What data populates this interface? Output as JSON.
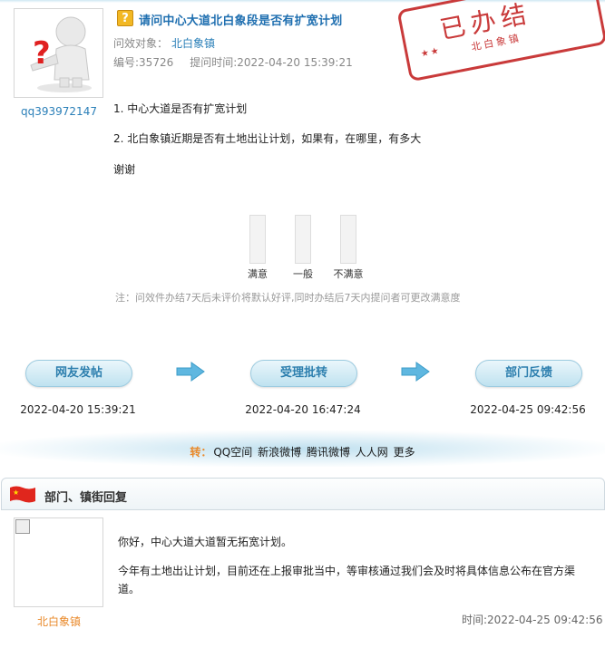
{
  "question": {
    "title": "请问中心大道北白象段是否有扩宽计划",
    "target_label": "问效对象：",
    "target": "北白象镇",
    "number": "编号:35726",
    "time": "提问时间:2022-04-20 15:39:21",
    "asker": "qq393972147",
    "body": [
      "1. 中心大道是否有扩宽计划",
      "2. 北白象镇近期是否有土地出让计划，如果有，在哪里，有多大",
      "谢谢"
    ]
  },
  "stamp": {
    "text": "已办结",
    "sub": "北白象镇"
  },
  "rating": {
    "options": [
      "满意",
      "一般",
      "不满意"
    ],
    "note": "注：问效件办结7天后未评价将默认好评,同时办结后7天内提问者可更改满意度"
  },
  "flow": [
    {
      "label": "网友发帖",
      "date": "2022-04-20 15:39:21"
    },
    {
      "label": "受理批转",
      "date": "2022-04-20 16:47:24"
    },
    {
      "label": "部门反馈",
      "date": "2022-04-25 09:42:56"
    }
  ],
  "share": {
    "prefix": "转：",
    "links": [
      "QQ空间",
      "新浪微博",
      "腾讯微博",
      "人人网",
      "更多"
    ]
  },
  "reply": {
    "section_title": "部门、镇街回复",
    "author": "北白象镇",
    "paragraphs": [
      "你好，中心大道大道暂无拓宽计划。",
      "今年有土地出让计划，目前还在上报审批当中，等审核通过我们会及时将具体信息公布在官方渠道。"
    ],
    "time": "时间:2022-04-25 09:42:56"
  },
  "colors": {
    "accent": "#2a7fb8",
    "orange": "#e9892a",
    "stamp": "#c93a3a"
  },
  "icons": [
    "question-person-icon",
    "question-icon",
    "arrow-right-icon",
    "china-flag-icon",
    "broken-image-icon"
  ]
}
